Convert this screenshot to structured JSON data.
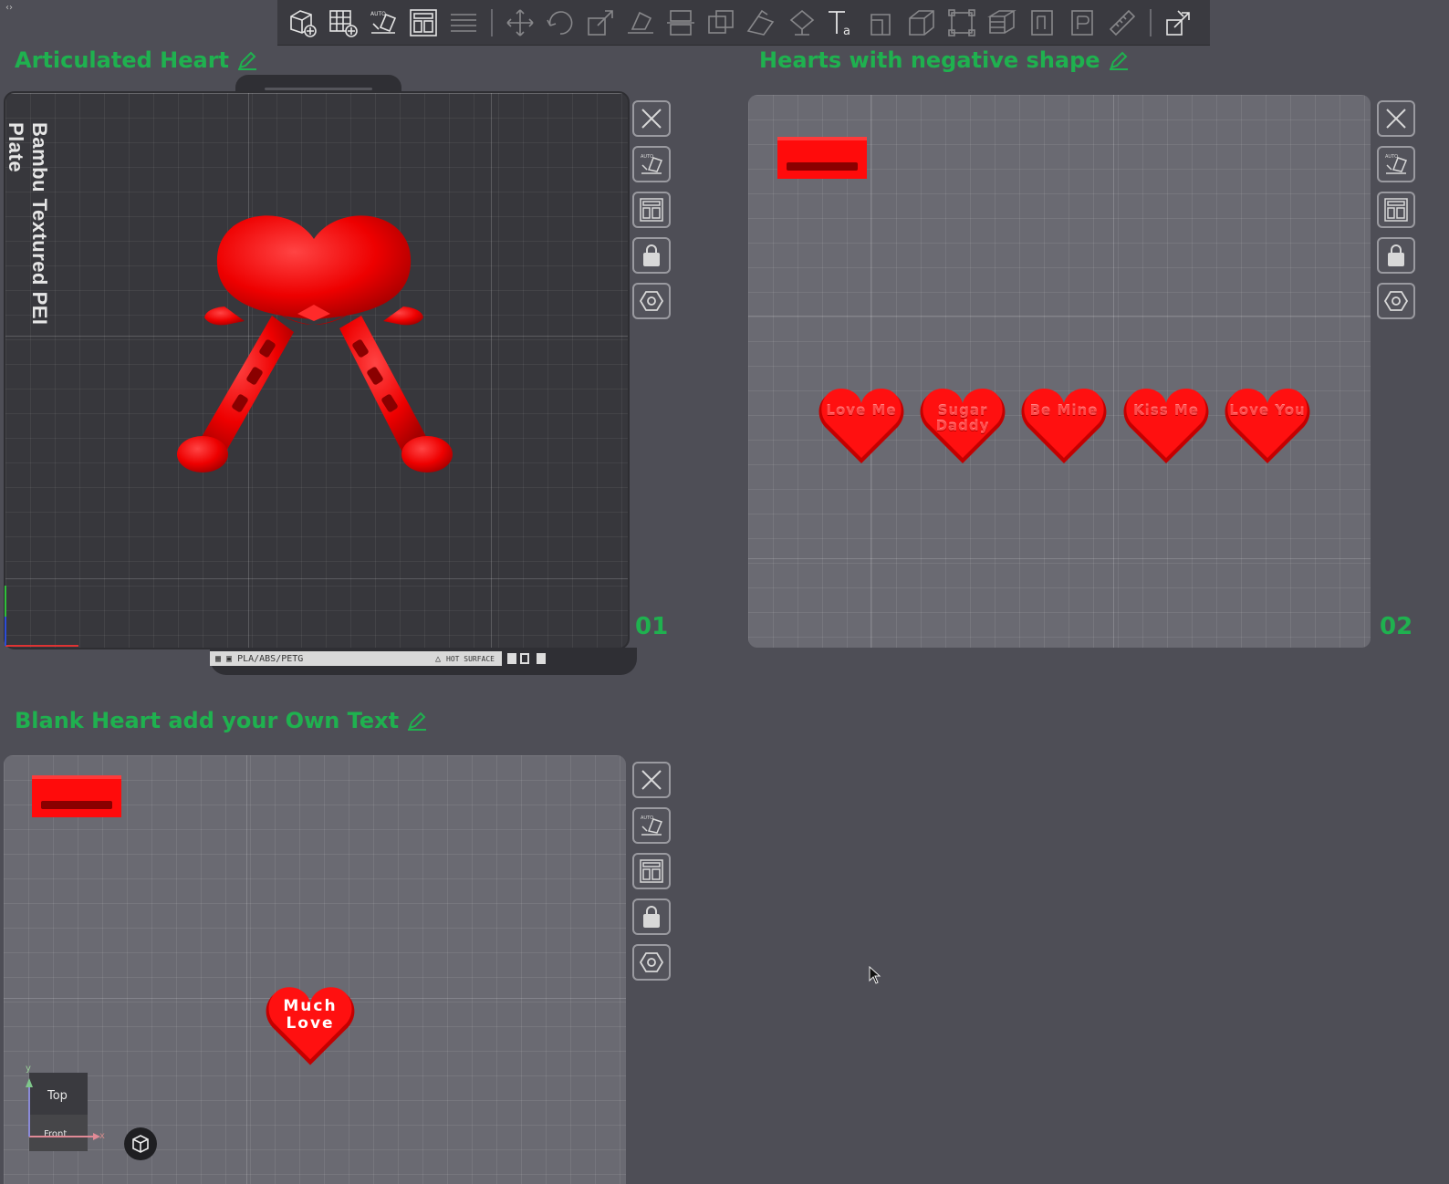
{
  "plates": [
    {
      "title": "Articulated Heart",
      "number": "01",
      "bed_label": "Bambu Textured PEI Plate",
      "footer_material": "PLA/ABS/PETG",
      "footer_surface": "HOT SURFACE"
    },
    {
      "title": "Hearts with negative shape",
      "number": "02",
      "hearts": [
        {
          "text": "Love Me"
        },
        {
          "text": "Sugar Daddy"
        },
        {
          "text": "Be Mine"
        },
        {
          "text": "Kiss Me"
        },
        {
          "text": "Love You"
        }
      ]
    },
    {
      "title": "Blank Heart add your Own Text",
      "heart_text": "Much Love"
    }
  ],
  "view_cube": {
    "top": "Top",
    "front": "Front"
  },
  "axis_labels": {
    "x": "x",
    "y": "y"
  },
  "toolbar": {
    "icons": [
      "add-cube-icon",
      "add-grid-plate-icon",
      "auto-orient-icon",
      "arrange-icon",
      "layers-icon",
      "move-icon",
      "rotate-icon",
      "scale-icon",
      "lay-on-face-icon",
      "cut-icon",
      "boolean-icon",
      "support-paint-icon",
      "seam-paint-icon",
      "text-icon",
      "emboss-icon",
      "measure-icon",
      "assembly-icon",
      "split-objects-icon",
      "split-parts-icon",
      "variable-layer-icon",
      "brim-icon",
      "ruler-icon",
      "assemble-view-icon"
    ]
  },
  "colors": {
    "accent_green": "#1fb14f",
    "model_red": "#ff0b0b",
    "background": "#4e4e56"
  }
}
